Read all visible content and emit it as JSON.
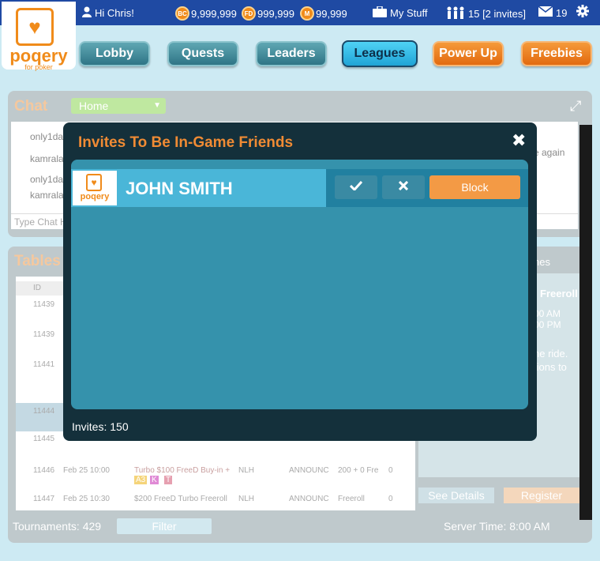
{
  "topbar": {
    "greeting": "Hi Chris!",
    "currencies": [
      {
        "badge": "BC",
        "amount": "9,999,999"
      },
      {
        "badge": "FD",
        "amount": "999,999"
      },
      {
        "badge": "M",
        "amount": "99,999"
      }
    ],
    "my_stuff": "My Stuff",
    "friends": "15 [2 invites]",
    "messages": "19"
  },
  "logo": {
    "name": "poqery",
    "tagline": "for poker"
  },
  "nav": [
    "Lobby",
    "Quests",
    "Leaders",
    "Leagues",
    "Power Up",
    "Freebies"
  ],
  "chat": {
    "title": "Chat",
    "room": "Home",
    "lines": [
      "only1da",
      "kamrala",
      "only1da",
      "kamrala"
    ],
    "right_text": "e again",
    "input_placeholder": "Type Chat H"
  },
  "tables": {
    "title": "Tables",
    "id_header": "ID",
    "rows": [
      {
        "id": "11439"
      },
      {
        "id": "11439"
      },
      {
        "id": "11441"
      },
      {
        "id": "11444"
      },
      {
        "id": "11445"
      },
      {
        "id": "11446",
        "date": "Feb 25 10:00",
        "name": "Turbo $100 FreeD Buy-in +",
        "game": "NLH",
        "status": "ANNOUNC",
        "fee": "200 + 0 Fre",
        "count": "0"
      },
      {
        "id": "11447",
        "date": "Feb 25 10:30",
        "name": "$200 FreeD Turbo Freeroll",
        "game": "NLH",
        "status": "ANNOUNC",
        "fee": "Freeroll",
        "count": "0"
      }
    ],
    "tags": [
      "A3",
      "K",
      "T"
    ],
    "detail_tab": "nes",
    "detail_title": "Freeroll",
    "detail_times": [
      "00 AM",
      "00 PM"
    ],
    "detail_text": [
      "he ride.",
      "tions to"
    ],
    "see_details": "See Details",
    "register": "Register",
    "tournaments": "Tournaments: 429",
    "filter": "Filter",
    "server_time": "Server Time: 8:00 AM"
  },
  "modal": {
    "title": "Invites To Be In-Game Friends",
    "invites": [
      {
        "name": "JOHN SMITH",
        "block_label": "Block"
      }
    ],
    "count_label": "Invites: 150"
  },
  "colors": {
    "brand_orange": "#f08b1a",
    "topbar_blue": "#1f4aa3",
    "modal_bg": "#14303b",
    "modal_body": "#3592ac"
  }
}
